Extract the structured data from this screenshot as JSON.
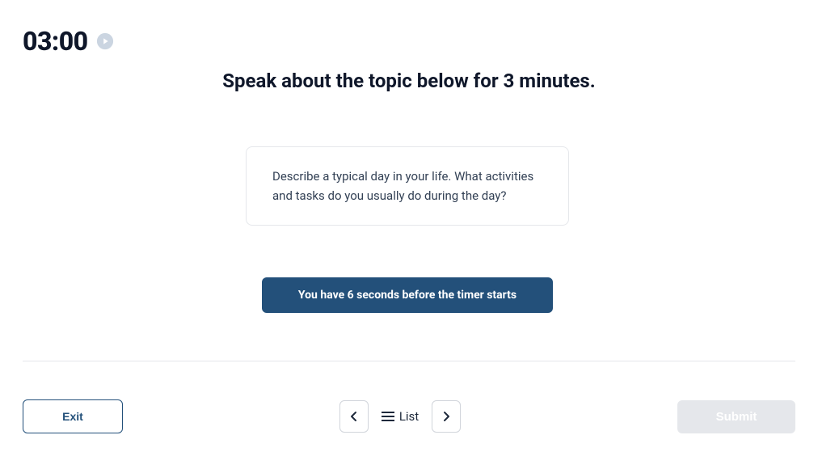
{
  "timer": "03:00",
  "instruction": "Speak about the topic below for 3 minutes.",
  "prompt": "Describe a typical day in your life. What activities and tasks do you usually do during the day?",
  "countdown": "You have 6 seconds before the timer starts",
  "footer": {
    "exit": "Exit",
    "list": "List",
    "submit": "Submit"
  }
}
